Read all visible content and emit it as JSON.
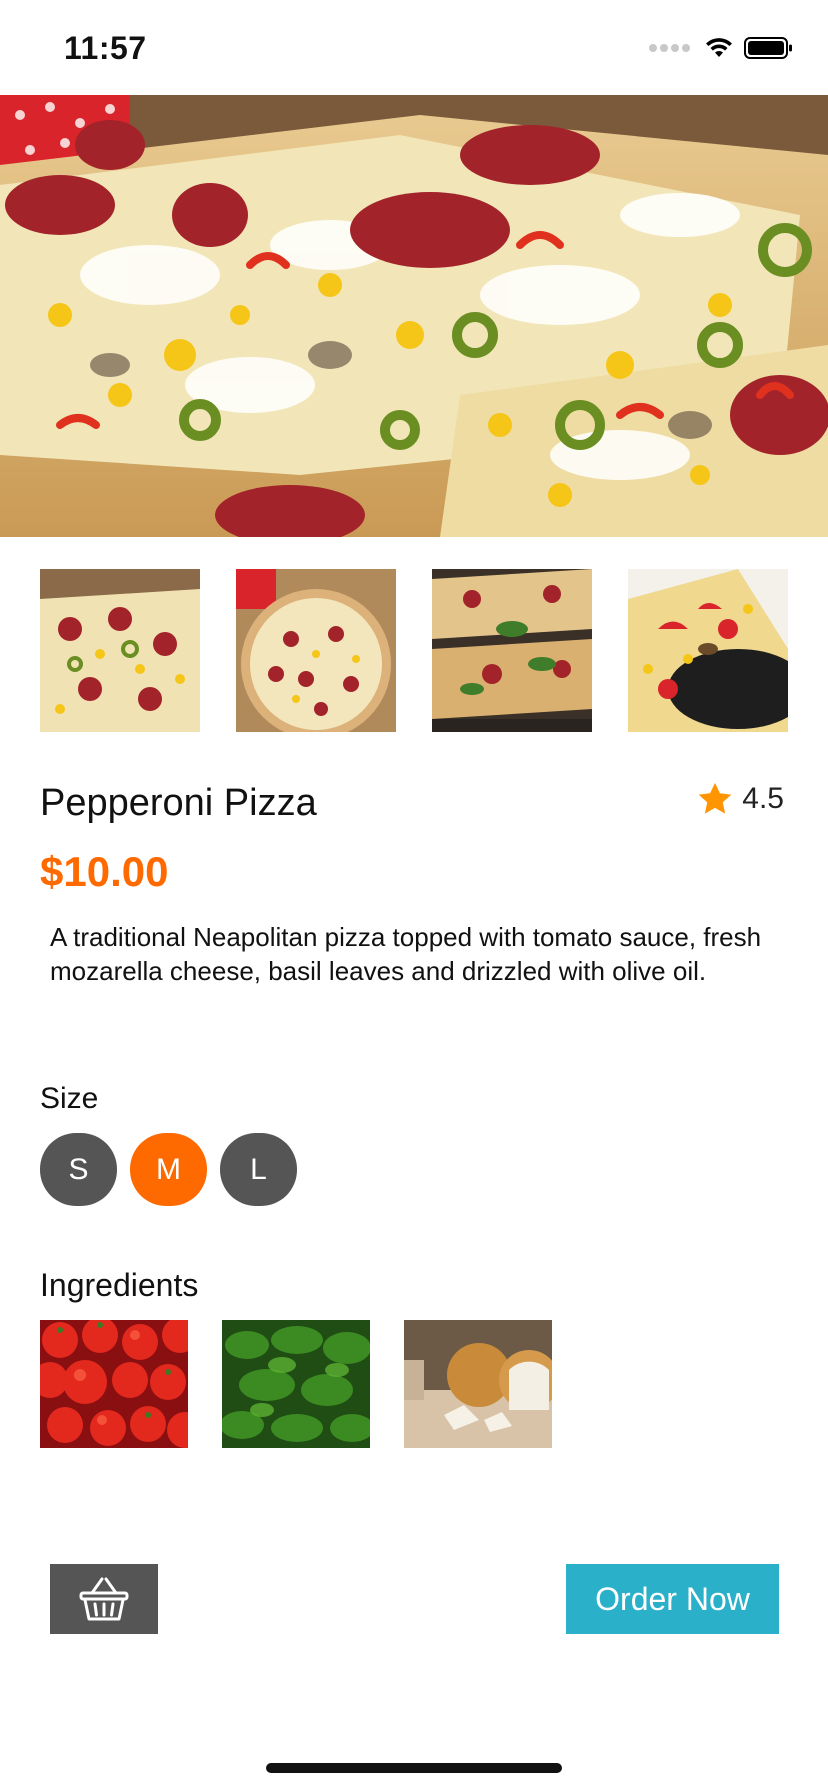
{
  "status": {
    "time": "11:57"
  },
  "product": {
    "title": "Pepperoni Pizza",
    "rating": "4.5",
    "price": "$10.00",
    "description": "A traditional Neapolitan pizza topped with tomato sauce, fresh mozarella cheese, basil leaves and drizzled with olive oil."
  },
  "size": {
    "label": "Size",
    "options": [
      "S",
      "M",
      "L"
    ],
    "selected": "M"
  },
  "ingredients": {
    "label": "Ingredients",
    "items": [
      "tomatoes",
      "parsley",
      "onions"
    ]
  },
  "actions": {
    "order_label": "Order Now",
    "basket_icon": "basket-icon"
  },
  "colors": {
    "accent": "#ff6a00",
    "order_button": "#2bb0c9",
    "size_button": "#555555",
    "star": "#ff9500"
  }
}
